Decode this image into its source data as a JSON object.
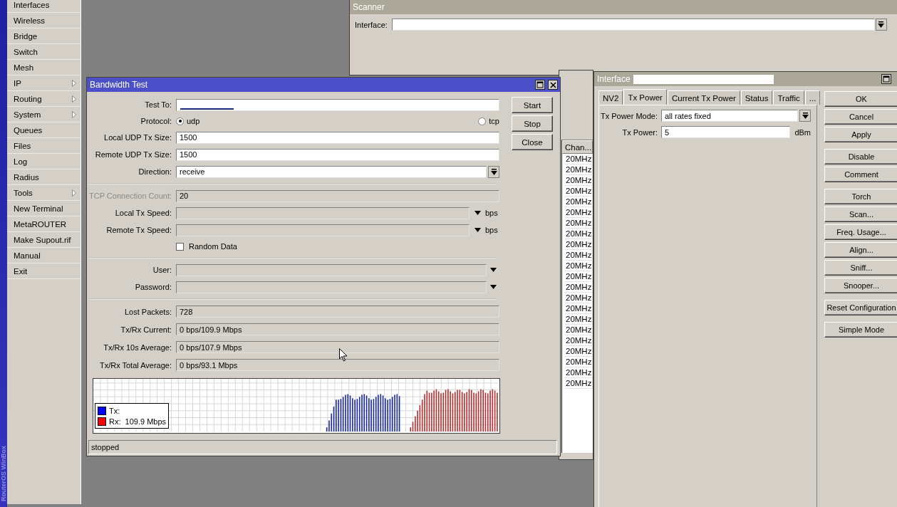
{
  "sidebar": {
    "brand": "RouterOS WinBox",
    "items": [
      {
        "label": "Interfaces",
        "submenu": false
      },
      {
        "label": "Wireless",
        "submenu": false
      },
      {
        "label": "Bridge",
        "submenu": false
      },
      {
        "label": "Switch",
        "submenu": false
      },
      {
        "label": "Mesh",
        "submenu": false
      },
      {
        "label": "IP",
        "submenu": true
      },
      {
        "label": "Routing",
        "submenu": true
      },
      {
        "label": "System",
        "submenu": true
      },
      {
        "label": "Queues",
        "submenu": false
      },
      {
        "label": "Files",
        "submenu": false
      },
      {
        "label": "Log",
        "submenu": false
      },
      {
        "label": "Radius",
        "submenu": false
      },
      {
        "label": "Tools",
        "submenu": true
      },
      {
        "label": "New Terminal",
        "submenu": false
      },
      {
        "label": "MetaROUTER",
        "submenu": false
      },
      {
        "label": "Make Supout.rif",
        "submenu": false
      },
      {
        "label": "Manual",
        "submenu": false
      },
      {
        "label": "Exit",
        "submenu": false
      }
    ]
  },
  "scanner": {
    "title": "Scanner",
    "interface_label": "Interface:"
  },
  "channel_list": {
    "column": "Chan...",
    "rows": [
      "20MHz",
      "20MHz",
      "20MHz",
      "20MHz",
      "20MHz",
      "20MHz",
      "20MHz",
      "20MHz",
      "20MHz",
      "20MHz",
      "20MHz",
      "20MHz",
      "20MHz",
      "20MHz",
      "20MHz",
      "20MHz",
      "20MHz",
      "20MHz",
      "20MHz",
      "20MHz",
      "20MHz",
      "20MHz"
    ]
  },
  "bandwidth_test": {
    "title": "Bandwidth Test",
    "rows": [
      {
        "kind": "text",
        "label": "Test To:"
      },
      {
        "kind": "radio",
        "label": "Protocol:",
        "options": [
          {
            "label": "udp",
            "selected": true
          },
          {
            "label": "tcp",
            "selected": false
          }
        ]
      },
      {
        "kind": "text",
        "label": "Local UDP Tx Size:",
        "value": "1500"
      },
      {
        "kind": "text",
        "label": "Remote UDP Tx Size:",
        "value": "1500"
      },
      {
        "kind": "select",
        "label": "Direction:",
        "value": "receive"
      },
      {
        "kind": "divider"
      },
      {
        "kind": "readonly",
        "label": "TCP Connection Count:",
        "value": "20",
        "disabled": true
      },
      {
        "kind": "speed",
        "label": "Local Tx Speed:",
        "unit": "bps"
      },
      {
        "kind": "speed",
        "label": "Remote Tx Speed:",
        "unit": "bps"
      },
      {
        "kind": "checkbox",
        "label": "Random Data",
        "checked": false
      },
      {
        "kind": "divider"
      },
      {
        "kind": "combo",
        "label": "User:"
      },
      {
        "kind": "combo",
        "label": "Password:"
      },
      {
        "kind": "divider"
      },
      {
        "kind": "readout",
        "label": "Lost Packets:",
        "value": "728"
      },
      {
        "kind": "readout",
        "label": "Tx/Rx Current:",
        "value": "0 bps/109.9 Mbps"
      },
      {
        "kind": "readout",
        "label": "Tx/Rx 10s Average:",
        "value": "0 bps/107.9 Mbps"
      },
      {
        "kind": "readout",
        "label": "Tx/Rx Total Average:",
        "value": "0 bps/93.1 Mbps"
      }
    ],
    "buttons": [
      "Start",
      "Stop",
      "Close"
    ],
    "legend": [
      {
        "label": "Tx:",
        "color": "#0000ff"
      },
      {
        "label": "Rx:  109.9 Mbps",
        "color": "#ff0000"
      }
    ],
    "status": "stopped"
  },
  "interface_window": {
    "title": "Interface",
    "tabs": [
      {
        "label": "NV2",
        "selected": false
      },
      {
        "label": "Tx Power",
        "selected": true
      },
      {
        "label": "Current Tx Power",
        "selected": false
      },
      {
        "label": "Status",
        "selected": false
      },
      {
        "label": "Traffic",
        "selected": false
      },
      {
        "label": "...",
        "selected": false
      }
    ],
    "fields": [
      {
        "kind": "select",
        "label": "Tx Power Mode:",
        "value": "all rates fixed"
      },
      {
        "kind": "unit",
        "label": "Tx Power:",
        "value": "5",
        "unit": "dBm"
      }
    ],
    "button_groups": [
      [
        "OK",
        "Cancel",
        "Apply"
      ],
      [
        "Disable",
        "Comment"
      ],
      [
        "Torch",
        "Scan...",
        "Freq. Usage...",
        "Align...",
        "Sniff...",
        "Snooper..."
      ],
      [
        "Reset Configuration"
      ],
      [
        "Simple Mode"
      ]
    ]
  }
}
